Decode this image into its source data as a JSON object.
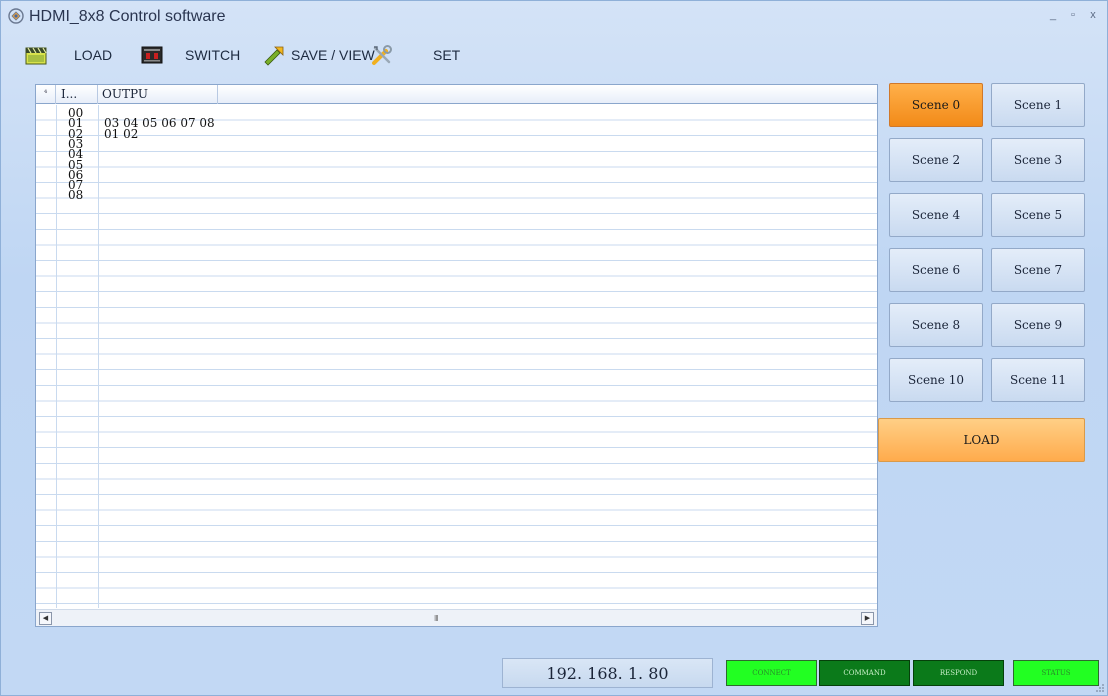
{
  "window": {
    "title": "HDMI_8x8 Control software",
    "minimize": "_",
    "maximize": "▫",
    "close": "x"
  },
  "toolbar": {
    "load_label": "LOAD",
    "switch_label": "SWITCH",
    "save_view_label": "SAVE / VIEW",
    "set_label": "SET"
  },
  "grid": {
    "select_header": "⁴",
    "input_header": "I...",
    "output_header": "OUTPU",
    "rows": [
      {
        "input": "00",
        "output": ""
      },
      {
        "input": "01",
        "output": "03 04 05 06 07 08"
      },
      {
        "input": "02",
        "output": "01 02"
      },
      {
        "input": "03",
        "output": ""
      },
      {
        "input": "04",
        "output": ""
      },
      {
        "input": "05",
        "output": ""
      },
      {
        "input": "06",
        "output": ""
      },
      {
        "input": "07",
        "output": ""
      },
      {
        "input": "08",
        "output": ""
      }
    ],
    "scroll_left": "◀",
    "scroll_right": "▶",
    "scroll_thumb": "III"
  },
  "scenes": [
    {
      "label": "Scene 0",
      "active": true
    },
    {
      "label": "Scene 1",
      "active": false
    },
    {
      "label": "Scene 2",
      "active": false
    },
    {
      "label": "Scene 3",
      "active": false
    },
    {
      "label": "Scene 4",
      "active": false
    },
    {
      "label": "Scene 5",
      "active": false
    },
    {
      "label": "Scene 6",
      "active": false
    },
    {
      "label": "Scene 7",
      "active": false
    },
    {
      "label": "Scene 8",
      "active": false
    },
    {
      "label": "Scene 9",
      "active": false
    },
    {
      "label": "Scene 10",
      "active": false
    },
    {
      "label": "Scene 11",
      "active": false
    }
  ],
  "scene_load_label": "LOAD",
  "status": {
    "ip": "192. 168. 1. 80",
    "connect": "CONNECT",
    "command": "COMMAND",
    "respond": "RESPOND",
    "status": "STATUS"
  },
  "colors": {
    "accent_orange": "#f28a18",
    "led_bright": "#22ff22",
    "led_dark": "#0b7a1a"
  }
}
